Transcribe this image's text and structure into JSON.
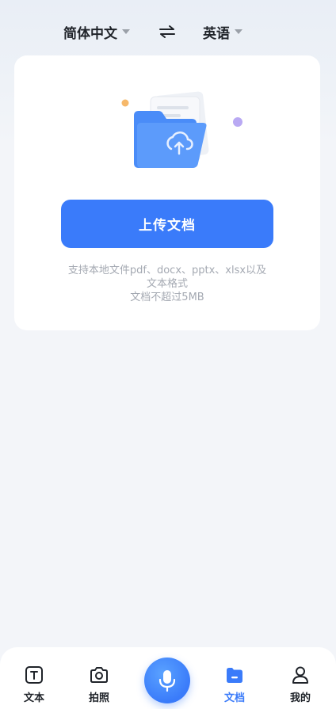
{
  "language_bar": {
    "source_language": "简体中文",
    "target_language": "英语"
  },
  "upload_card": {
    "upload_button_label": "上传文档",
    "hint_line_1": "支持本地文件pdf、docx、pptx、xlsx以及",
    "hint_line_2": "文本格式",
    "hint_line_3": "文档不超过5MB"
  },
  "bottom_nav": {
    "items": [
      {
        "label": "文本",
        "icon": "text-icon"
      },
      {
        "label": "拍照",
        "icon": "camera-icon"
      },
      {
        "label": "文档",
        "icon": "document-folder-icon",
        "active": true
      },
      {
        "label": "我的",
        "icon": "user-icon"
      }
    ],
    "center_button_icon": "microphone-icon"
  },
  "colors": {
    "accent": "#3a7bfa",
    "background": "#f3f5f9",
    "card": "#ffffff",
    "hint_text": "#a4a9b2"
  }
}
